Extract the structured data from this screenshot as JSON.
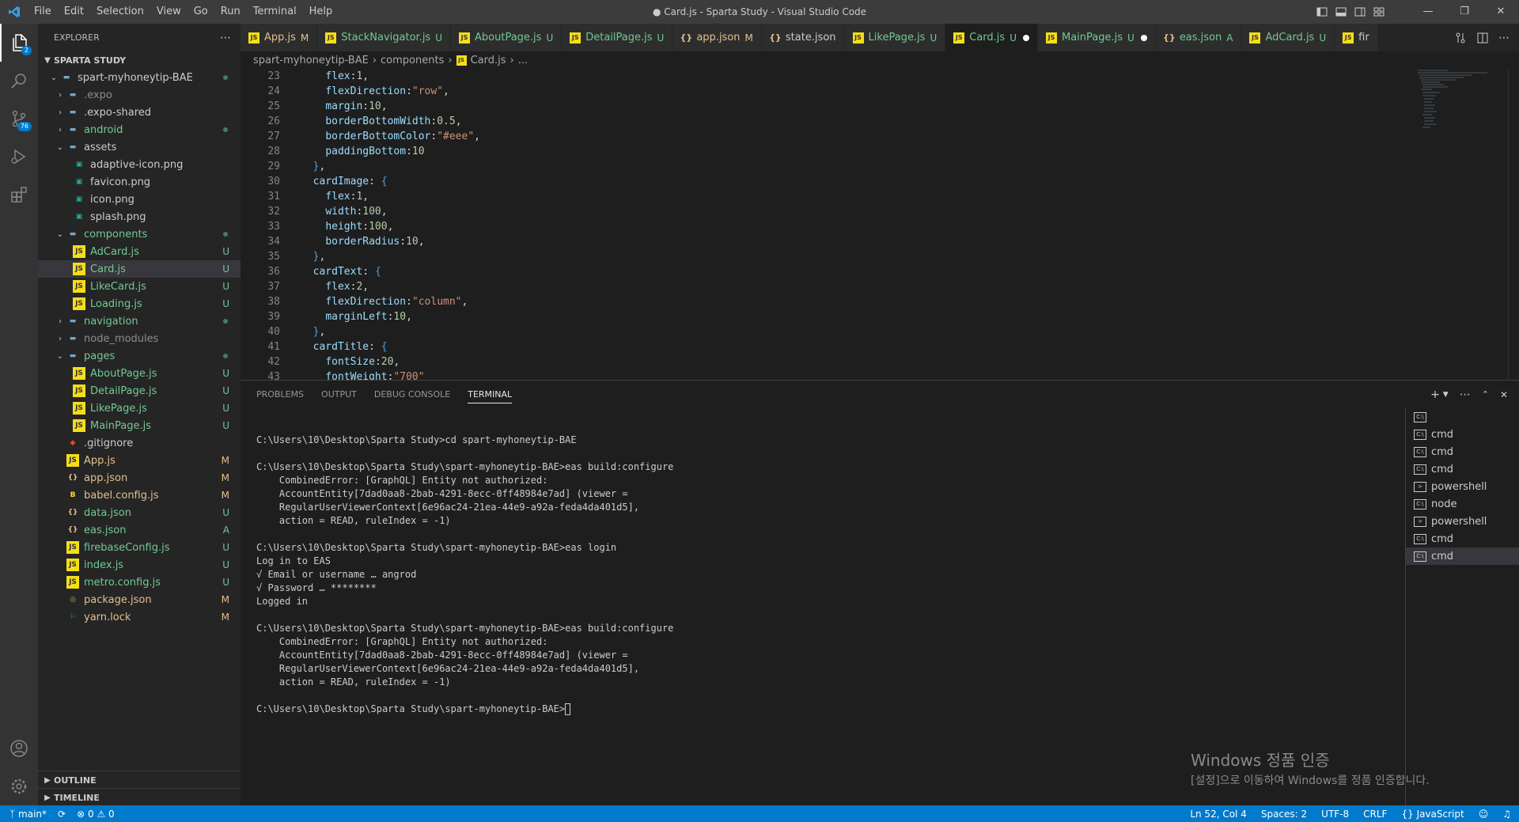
{
  "window": {
    "title": "● Card.js - Sparta Study - Visual Studio Code",
    "menu": [
      "File",
      "Edit",
      "Selection",
      "View",
      "Go",
      "Run",
      "Terminal",
      "Help"
    ]
  },
  "activity": {
    "explorer_badge": "2",
    "scm_badge": "76"
  },
  "sidebar": {
    "header": "EXPLORER",
    "workspace": "SPARTA STUDY",
    "tree": [
      {
        "label": "spart-myhoneytip-BAE",
        "depth": 1,
        "type": "folder-open",
        "stat": "dot",
        "color": "c-text"
      },
      {
        "label": ".expo",
        "depth": 2,
        "type": "folder",
        "stat": "",
        "color": "c-grey"
      },
      {
        "label": ".expo-shared",
        "depth": 2,
        "type": "folder",
        "stat": "",
        "color": "c-text"
      },
      {
        "label": "android",
        "depth": 2,
        "type": "folder",
        "stat": "dot",
        "color": "c-green"
      },
      {
        "label": "assets",
        "depth": 2,
        "type": "folder-open",
        "stat": "",
        "color": "c-text"
      },
      {
        "label": "adaptive-icon.png",
        "depth": 3,
        "type": "img",
        "stat": "",
        "color": "c-text"
      },
      {
        "label": "favicon.png",
        "depth": 3,
        "type": "img",
        "stat": "",
        "color": "c-text"
      },
      {
        "label": "icon.png",
        "depth": 3,
        "type": "img",
        "stat": "",
        "color": "c-text"
      },
      {
        "label": "splash.png",
        "depth": 3,
        "type": "img",
        "stat": "",
        "color": "c-text"
      },
      {
        "label": "components",
        "depth": 2,
        "type": "folder-open",
        "stat": "dot",
        "color": "c-green"
      },
      {
        "label": "AdCard.js",
        "depth": 3,
        "type": "js",
        "stat": "U",
        "color": "c-green"
      },
      {
        "label": "Card.js",
        "depth": 3,
        "type": "js",
        "stat": "U",
        "color": "c-green",
        "selected": true
      },
      {
        "label": "LikeCard.js",
        "depth": 3,
        "type": "js",
        "stat": "U",
        "color": "c-green"
      },
      {
        "label": "Loading.js",
        "depth": 3,
        "type": "js",
        "stat": "U",
        "color": "c-green"
      },
      {
        "label": "navigation",
        "depth": 2,
        "type": "folder",
        "stat": "dot",
        "color": "c-green"
      },
      {
        "label": "node_modules",
        "depth": 2,
        "type": "folder",
        "stat": "",
        "color": "c-grey"
      },
      {
        "label": "pages",
        "depth": 2,
        "type": "folder-open",
        "stat": "dot",
        "color": "c-green"
      },
      {
        "label": "AboutPage.js",
        "depth": 3,
        "type": "js",
        "stat": "U",
        "color": "c-green"
      },
      {
        "label": "DetailPage.js",
        "depth": 3,
        "type": "js",
        "stat": "U",
        "color": "c-green"
      },
      {
        "label": "LikePage.js",
        "depth": 3,
        "type": "js",
        "stat": "U",
        "color": "c-green"
      },
      {
        "label": "MainPage.js",
        "depth": 3,
        "type": "js",
        "stat": "U",
        "color": "c-green"
      },
      {
        "label": ".gitignore",
        "depth": 2,
        "type": "git",
        "stat": "",
        "color": "c-text"
      },
      {
        "label": "App.js",
        "depth": 2,
        "type": "js",
        "stat": "M",
        "color": "c-yellow"
      },
      {
        "label": "app.json",
        "depth": 2,
        "type": "json",
        "stat": "M",
        "color": "c-yellow"
      },
      {
        "label": "babel.config.js",
        "depth": 2,
        "type": "babel",
        "stat": "M",
        "color": "c-yellow"
      },
      {
        "label": "data.json",
        "depth": 2,
        "type": "json",
        "stat": "U",
        "color": "c-green"
      },
      {
        "label": "eas.json",
        "depth": 2,
        "type": "json",
        "stat": "A",
        "color": "c-green"
      },
      {
        "label": "firebaseConfig.js",
        "depth": 2,
        "type": "js",
        "stat": "U",
        "color": "c-green"
      },
      {
        "label": "index.js",
        "depth": 2,
        "type": "js",
        "stat": "U",
        "color": "c-green"
      },
      {
        "label": "metro.config.js",
        "depth": 2,
        "type": "js",
        "stat": "U",
        "color": "c-green"
      },
      {
        "label": "package.json",
        "depth": 2,
        "type": "npm",
        "stat": "M",
        "color": "c-yellow"
      },
      {
        "label": "yarn.lock",
        "depth": 2,
        "type": "yarn",
        "stat": "M",
        "color": "c-yellow"
      }
    ],
    "outline": "OUTLINE",
    "timeline": "TIMELINE"
  },
  "tabs": [
    {
      "label": "App.js",
      "type": "js",
      "stat": "M",
      "color": "c-yellow"
    },
    {
      "label": "StackNavigator.js",
      "type": "js",
      "stat": "U",
      "color": "c-green"
    },
    {
      "label": "AboutPage.js",
      "type": "js",
      "stat": "U",
      "color": "c-green"
    },
    {
      "label": "DetailPage.js",
      "type": "js",
      "stat": "U",
      "color": "c-green"
    },
    {
      "label": "app.json",
      "type": "json",
      "stat": "M",
      "color": "c-yellow"
    },
    {
      "label": "state.json",
      "type": "json",
      "stat": "",
      "color": "c-text"
    },
    {
      "label": "LikePage.js",
      "type": "js",
      "stat": "U",
      "color": "c-green"
    },
    {
      "label": "Card.js",
      "type": "js",
      "stat": "U",
      "color": "c-green",
      "active": true,
      "dirty": true
    },
    {
      "label": "MainPage.js",
      "type": "js",
      "stat": "U",
      "color": "c-green",
      "dirty": true
    },
    {
      "label": "eas.json",
      "type": "json",
      "stat": "A",
      "color": "c-green"
    },
    {
      "label": "AdCard.js",
      "type": "js",
      "stat": "U",
      "color": "c-green"
    },
    {
      "label": "fir",
      "type": "js",
      "stat": "",
      "color": "c-text"
    }
  ],
  "breadcrumb": [
    "spart-myhoneytip-BAE",
    "components",
    "Card.js",
    "..."
  ],
  "editor": {
    "lines": [
      {
        "n": "23",
        "indent": "    ",
        "tokens": [
          [
            "prop",
            "flex"
          ],
          [
            "pun",
            ":"
          ],
          [
            "num",
            "1"
          ],
          [
            "pun",
            ","
          ]
        ]
      },
      {
        "n": "24",
        "indent": "    ",
        "tokens": [
          [
            "prop",
            "flexDirection"
          ],
          [
            "pun",
            ":"
          ],
          [
            "str",
            "\"row\""
          ],
          [
            "pun",
            ","
          ]
        ]
      },
      {
        "n": "25",
        "indent": "    ",
        "tokens": [
          [
            "prop",
            "margin"
          ],
          [
            "pun",
            ":"
          ],
          [
            "num",
            "10"
          ],
          [
            "pun",
            ","
          ]
        ]
      },
      {
        "n": "26",
        "indent": "    ",
        "tokens": [
          [
            "prop",
            "borderBottomWidth"
          ],
          [
            "pun",
            ":"
          ],
          [
            "num",
            "0.5"
          ],
          [
            "pun",
            ","
          ]
        ]
      },
      {
        "n": "27",
        "indent": "    ",
        "tokens": [
          [
            "prop",
            "borderBottomColor"
          ],
          [
            "pun",
            ":"
          ],
          [
            "str",
            "\"#eee\""
          ],
          [
            "pun",
            ","
          ]
        ]
      },
      {
        "n": "28",
        "indent": "    ",
        "tokens": [
          [
            "prop",
            "paddingBottom"
          ],
          [
            "pun",
            ":"
          ],
          [
            "num",
            "10"
          ]
        ]
      },
      {
        "n": "29",
        "indent": "  ",
        "tokens": [
          [
            "brk",
            "}"
          ],
          [
            "pun",
            ","
          ]
        ]
      },
      {
        "n": "30",
        "indent": "  ",
        "tokens": [
          [
            "prop",
            "cardImage"
          ],
          [
            "pun",
            ": "
          ],
          [
            "brk",
            "{"
          ]
        ]
      },
      {
        "n": "31",
        "indent": "    ",
        "tokens": [
          [
            "prop",
            "flex"
          ],
          [
            "pun",
            ":"
          ],
          [
            "num",
            "1"
          ],
          [
            "pun",
            ","
          ]
        ]
      },
      {
        "n": "32",
        "indent": "    ",
        "tokens": [
          [
            "prop",
            "width"
          ],
          [
            "pun",
            ":"
          ],
          [
            "num",
            "100"
          ],
          [
            "pun",
            ","
          ]
        ]
      },
      {
        "n": "33",
        "indent": "    ",
        "tokens": [
          [
            "prop",
            "height"
          ],
          [
            "pun",
            ":"
          ],
          [
            "num",
            "100"
          ],
          [
            "pun",
            ","
          ]
        ]
      },
      {
        "n": "34",
        "indent": "    ",
        "tokens": [
          [
            "prop",
            "borderRadius"
          ],
          [
            "pun",
            ":"
          ],
          [
            "num",
            "10"
          ],
          [
            "pun",
            ","
          ]
        ]
      },
      {
        "n": "35",
        "indent": "  ",
        "tokens": [
          [
            "brk",
            "}"
          ],
          [
            "pun",
            ","
          ]
        ]
      },
      {
        "n": "36",
        "indent": "  ",
        "tokens": [
          [
            "prop",
            "cardText"
          ],
          [
            "pun",
            ": "
          ],
          [
            "brk",
            "{"
          ]
        ]
      },
      {
        "n": "37",
        "indent": "    ",
        "tokens": [
          [
            "prop",
            "flex"
          ],
          [
            "pun",
            ":"
          ],
          [
            "num",
            "2"
          ],
          [
            "pun",
            ","
          ]
        ]
      },
      {
        "n": "38",
        "indent": "    ",
        "tokens": [
          [
            "prop",
            "flexDirection"
          ],
          [
            "pun",
            ":"
          ],
          [
            "str",
            "\"column\""
          ],
          [
            "pun",
            ","
          ]
        ]
      },
      {
        "n": "39",
        "indent": "    ",
        "tokens": [
          [
            "prop",
            "marginLeft"
          ],
          [
            "pun",
            ":"
          ],
          [
            "num",
            "10"
          ],
          [
            "pun",
            ","
          ]
        ]
      },
      {
        "n": "40",
        "indent": "  ",
        "tokens": [
          [
            "brk",
            "}"
          ],
          [
            "pun",
            ","
          ]
        ]
      },
      {
        "n": "41",
        "indent": "  ",
        "tokens": [
          [
            "prop",
            "cardTitle"
          ],
          [
            "pun",
            ": "
          ],
          [
            "brk",
            "{"
          ]
        ]
      },
      {
        "n": "42",
        "indent": "    ",
        "tokens": [
          [
            "prop",
            "fontSize"
          ],
          [
            "pun",
            ":"
          ],
          [
            "num",
            "20"
          ],
          [
            "pun",
            ","
          ]
        ]
      },
      {
        "n": "43",
        "indent": "    ",
        "tokens": [
          [
            "prop",
            "fontWeight"
          ],
          [
            "pun",
            ":"
          ],
          [
            "str",
            "\"700\""
          ]
        ]
      }
    ]
  },
  "panel": {
    "tabs": [
      "PROBLEMS",
      "OUTPUT",
      "DEBUG CONSOLE",
      "TERMINAL"
    ],
    "active_tab": "TERMINAL",
    "terminal_lines": [
      "",
      "C:\\Users\\10\\Desktop\\Sparta Study>cd spart-myhoneytip-BAE",
      "",
      "C:\\Users\\10\\Desktop\\Sparta Study\\spart-myhoneytip-BAE>eas build:configure",
      "    CombinedError: [GraphQL] Entity not authorized:",
      "    AccountEntity[7dad0aa8-2bab-4291-8ecc-0ff48984e7ad] (viewer =",
      "    RegularUserViewerContext[6e96ac24-21ea-44e9-a92a-feda4da401d5],",
      "    action = READ, ruleIndex = -1)",
      "",
      "C:\\Users\\10\\Desktop\\Sparta Study\\spart-myhoneytip-BAE>eas login",
      "Log in to EAS",
      "√ Email or username … angrod",
      "√ Password … ********",
      "Logged in",
      "",
      "C:\\Users\\10\\Desktop\\Sparta Study\\spart-myhoneytip-BAE>eas build:configure",
      "    CombinedError: [GraphQL] Entity not authorized:",
      "    AccountEntity[7dad0aa8-2bab-4291-8ecc-0ff48984e7ad] (viewer =",
      "    RegularUserViewerContext[6e96ac24-21ea-44e9-a92a-feda4da401d5],",
      "    action = READ, ruleIndex = -1)",
      ""
    ],
    "prompt": "C:\\Users\\10\\Desktop\\Sparta Study\\spart-myhoneytip-BAE>",
    "terminals": [
      {
        "label": "",
        "kind": "cmd"
      },
      {
        "label": "cmd",
        "kind": "cmd"
      },
      {
        "label": "cmd",
        "kind": "cmd"
      },
      {
        "label": "cmd",
        "kind": "cmd"
      },
      {
        "label": "powershell",
        "kind": "ps"
      },
      {
        "label": "node",
        "kind": "cmd"
      },
      {
        "label": "powershell",
        "kind": "ps"
      },
      {
        "label": "cmd",
        "kind": "cmd"
      },
      {
        "label": "cmd",
        "kind": "cmd",
        "selected": true
      }
    ]
  },
  "watermark": {
    "line1": "Windows 정품 인증",
    "line2": "[설정]으로 이동하여 Windows를 정품 인증합니다."
  },
  "status": {
    "branch": "main*",
    "errors": "0",
    "warnings": "0",
    "position": "Ln 52, Col 4",
    "spaces": "Spaces: 2",
    "encoding": "UTF-8",
    "eol": "CRLF",
    "language": "JavaScript"
  },
  "colors": {
    "accent": "#007acc",
    "added": "#73c991",
    "modified": "#e2c08d"
  }
}
